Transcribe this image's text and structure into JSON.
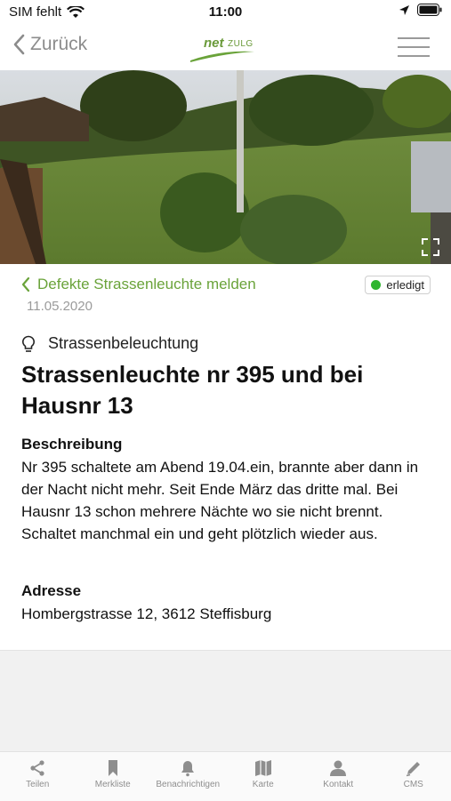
{
  "status_bar": {
    "carrier": "SIM fehlt",
    "time": "11:00"
  },
  "nav": {
    "back_label": "Zurück",
    "logo_text": "net",
    "logo_sub": "ZULG"
  },
  "report": {
    "category": "Defekte Strassenleuchte melden",
    "status": "erledigt",
    "status_color": "#2fb52f",
    "date": "11.05.2020",
    "type": "Strassenbeleuchtung",
    "title": "Strassenleuchte nr 395 und bei Hausnr 13",
    "description_label": "Beschreibung",
    "description": "Nr 395 schaltete am Abend 19.04.ein, brannte aber dann in der Nacht nicht mehr. Seit Ende März das dritte mal. Bei Hausnr 13 schon mehrere Nächte wo sie nicht brennt. Schaltet manchmal ein und geht plötzlich wieder aus.",
    "address_label": "Adresse",
    "address": "Hombergstrasse 12, 3612 Steffisburg"
  },
  "tabs": [
    {
      "label": "Teilen",
      "icon": "share-icon"
    },
    {
      "label": "Merkliste",
      "icon": "bookmark-icon"
    },
    {
      "label": "Benachrichtigen",
      "icon": "bell-icon"
    },
    {
      "label": "Karte",
      "icon": "map-icon"
    },
    {
      "label": "Kontakt",
      "icon": "person-icon"
    },
    {
      "label": "CMS",
      "icon": "pencil-icon"
    }
  ],
  "colors": {
    "accent": "#6aa33a",
    "muted": "#9b9b9b"
  }
}
